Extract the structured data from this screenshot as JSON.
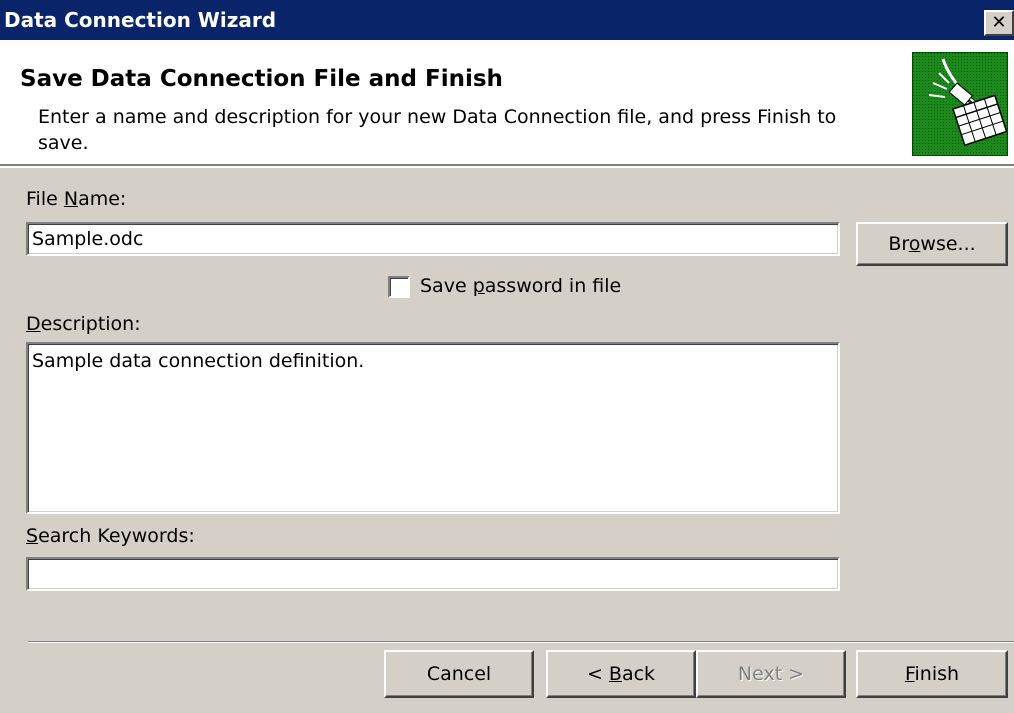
{
  "window": {
    "title": "Data Connection Wizard",
    "close_glyph": "✕"
  },
  "header": {
    "title": "Save Data Connection File and Finish",
    "subtitle": "Enter a name and description for your new Data Connection file, and press Finish to save.",
    "icon": "plug-spreadsheet-icon",
    "icon_color": "#0e7a0e"
  },
  "form": {
    "file_name_label": {
      "before": "File ",
      "mnemonic": "N",
      "after": "ame:"
    },
    "file_name_value": "Sample.odc",
    "browse_button": {
      "before": "Br",
      "mnemonic": "o",
      "after": "wse..."
    },
    "save_password": {
      "before": "Save ",
      "mnemonic": "p",
      "after": "assword in file",
      "checked": false
    },
    "description_label": {
      "before": "",
      "mnemonic": "D",
      "after": "escription:"
    },
    "description_value": "Sample data connection definition.",
    "keywords_label": {
      "before": "",
      "mnemonic": "S",
      "after": "earch Keywords:"
    },
    "keywords_value": ""
  },
  "footer": {
    "cancel": "Cancel",
    "back": {
      "before": "< ",
      "mnemonic": "B",
      "after": "ack"
    },
    "next": "Next >",
    "next_disabled": true,
    "finish": {
      "before": "",
      "mnemonic": "F",
      "after": "inish"
    }
  }
}
